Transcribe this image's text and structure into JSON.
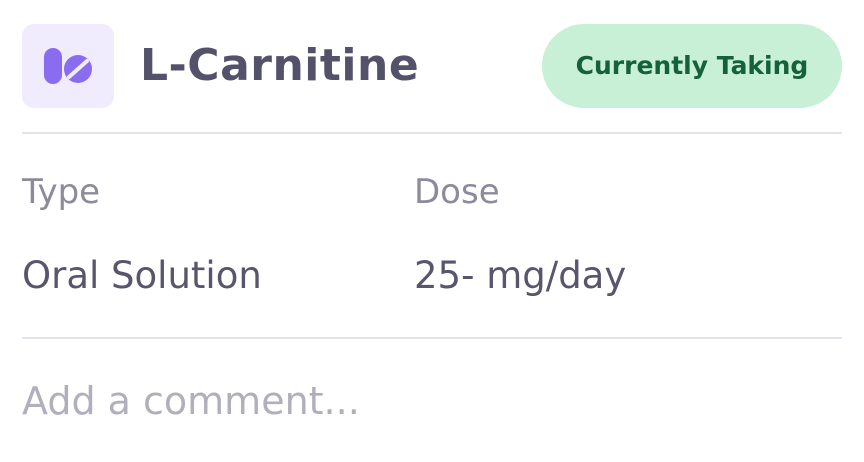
{
  "medication": {
    "icon": "pill-icon",
    "name": "L-Carnitine",
    "status": "Currently Taking"
  },
  "details": {
    "type_label": "Type",
    "type_value": "Oral Solution",
    "dose_label": "Dose",
    "dose_value": "25- mg/day"
  },
  "comment": {
    "placeholder": "Add a comment..."
  },
  "colors": {
    "icon_bg": "#f0ebfd",
    "icon_fg": "#8a6cf0",
    "badge_bg": "#c7f0d6",
    "badge_text": "#15613a",
    "title_text": "#54516b",
    "divider": "#e3e3ec"
  }
}
